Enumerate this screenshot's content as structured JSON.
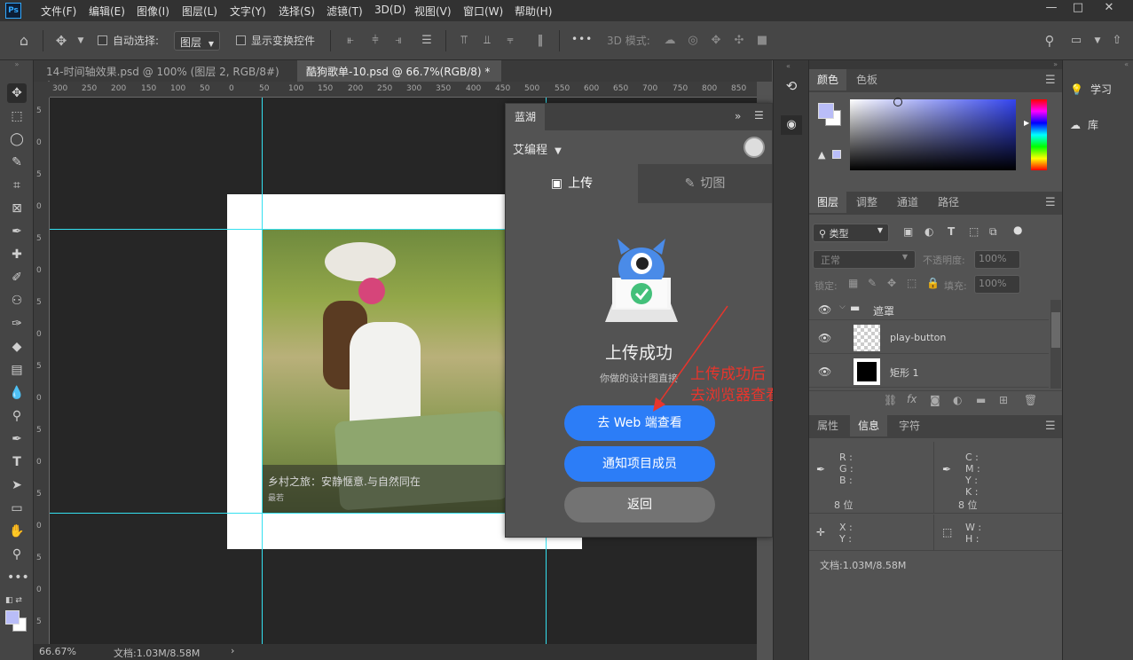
{
  "menubar": {
    "logo": "Ps",
    "items": [
      "文件(F)",
      "编辑(E)",
      "图像(I)",
      "图层(L)",
      "文字(Y)",
      "选择(S)",
      "滤镜(T)",
      "3D(D)",
      "视图(V)",
      "窗口(W)",
      "帮助(H)"
    ],
    "window_controls": [
      "—",
      "□",
      "✕"
    ]
  },
  "options": {
    "auto_select_label": "自动选择:",
    "auto_select_value": "图层",
    "show_transform_label": "显示变换控件",
    "more": "•••",
    "mode_3d_label": "3D 模式:"
  },
  "tabs": [
    {
      "label": "14-时间轴效果.psd @ 100% (图层 2, RGB/8#) *",
      "close": "×",
      "active": false
    },
    {
      "label": "酷狗歌单-10.psd @ 66.7%(RGB/8) *",
      "close": "×",
      "active": true
    }
  ],
  "ruler": {
    "top_ticks": [
      "300",
      "250",
      "200",
      "150",
      "100",
      "50",
      "0",
      "50",
      "100",
      "150",
      "200",
      "250",
      "300",
      "350",
      "400",
      "450",
      "500",
      "550",
      "600",
      "650",
      "700",
      "750",
      "800",
      "850"
    ],
    "left_ticks": [
      "5",
      "0",
      "5",
      "0",
      "5",
      "0",
      "5",
      "0",
      "5",
      "0",
      "5",
      "0",
      "5",
      "0",
      "5",
      "0",
      "5"
    ]
  },
  "canvas": {
    "caption_title": "乡村之旅：安静惬意.与自然同在",
    "caption_sub": "最若"
  },
  "plugin": {
    "panel_tab": "蓝湖",
    "collapse": "»",
    "team_name": "艾编程",
    "tab_upload": "上传",
    "tab_slice": "切图",
    "success_title": "上传成功",
    "success_sub": "你做的设计图直接",
    "btn_web": "去 Web 端查看",
    "btn_notify": "通知项目成员",
    "btn_back": "返回",
    "annotation_line1": "上传成功后",
    "annotation_line2": "去浏览器查看即可",
    "colors": {
      "primary": "#2c7df7",
      "secondary": "#737373",
      "annotation": "#e8352c"
    }
  },
  "color_panel": {
    "tabs": [
      "颜色",
      "色板"
    ]
  },
  "layers_panel": {
    "tabs": [
      "图层",
      "调整",
      "通道",
      "路径"
    ],
    "filter_label": "类型",
    "blend_mode": "正常",
    "opacity_label": "不透明度:",
    "opacity_value": "100%",
    "lock_label": "锁定:",
    "fill_label": "填充:",
    "fill_value": "100%",
    "layers": [
      {
        "name": "遮罩",
        "type": "group"
      },
      {
        "name": "play-button",
        "type": "smart"
      },
      {
        "name": "矩形 1",
        "type": "shape"
      }
    ]
  },
  "info_panel": {
    "tabs": [
      "属性",
      "信息",
      "字符"
    ],
    "rgb_labels": [
      "R :",
      "G :",
      "B :"
    ],
    "cmyk_labels": [
      "C :",
      "M :",
      "Y :",
      "K :"
    ],
    "bits_left": "8 位",
    "bits_right": "8 位",
    "xy_labels": [
      "X :",
      "Y :"
    ],
    "wh_labels": [
      "W :",
      "H :"
    ],
    "doc_info": "文档:1.03M/8.58M"
  },
  "right_dock": {
    "learn": "学习",
    "library": "库"
  },
  "status": {
    "zoom": "66.67%",
    "doc": "文档:1.03M/8.58M",
    "arrow": "›"
  }
}
